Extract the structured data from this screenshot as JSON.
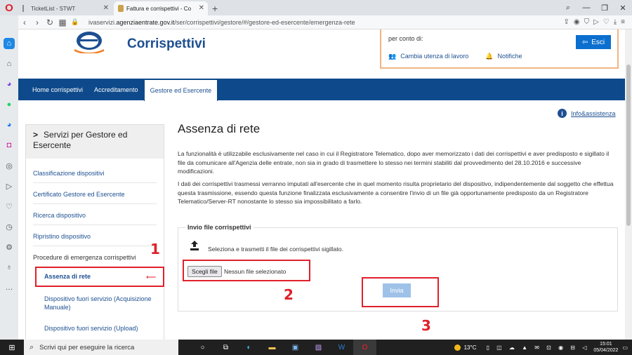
{
  "browser": {
    "tabs": [
      {
        "title": "TicketList - STWT",
        "active": false
      },
      {
        "title": "Fattura e corrispettivi - Co",
        "active": true
      }
    ],
    "url_prefix": "ivaservizi.",
    "url_domain": "agenziaentrate.gov.it",
    "url_path": "/ser/corrispettivi/gestore/#/gestore-ed-esercente/emergenza-rete"
  },
  "header": {
    "app_title": "Corrispettivi",
    "on_behalf_label": "per conto di:",
    "change_user_label": "Cambia utenza di lavoro",
    "notifications_label": "Notifiche",
    "exit_label": "Esci"
  },
  "nav": {
    "items": [
      "Home corrispettivi",
      "Accreditamento",
      "Gestore ed Esercente"
    ],
    "active_index": 2
  },
  "help_link": "Info&assistenza",
  "left_menu": {
    "title": "Servizi per Gestore ed Esercente",
    "items": [
      "Classificazione dispositivi",
      "Certificato Gestore ed Esercente",
      "Ricerca dispositivo",
      "Ripristino dispositivo"
    ],
    "group_label": "Procedure di emergenza corrispettivi",
    "sub_items": [
      "Assenza di rete",
      "Dispositivo fuori servizio (Acquisizione Manuale)",
      "Dispositivo fuori servizio (Upload)"
    ],
    "selected_sub": "Assenza di rete"
  },
  "main": {
    "title": "Assenza di rete",
    "paragraph1": "La funzionalità è utilizzabile esclusivamente nel caso in cui il Registratore Telematico, dopo aver memorizzato i dati dei corrispettivi e aver predisposto e sigillato il file da comunicare all'Agenzia delle entrate, non sia in grado di trasmettere lo stesso nei termini stabiliti dal provvedimento del 28.10.2016 e successive modificazioni.",
    "paragraph2": "I dati dei corrispettivi trasmessi verranno imputati all'esercente che in quel momento risulta proprietario del dispositivo, indipendentemente dal soggetto che effettua questa trasmissione, essendo questa funzione finalizzata esclusivamente a consentire l'invio di un file già opportunamente predisposto da un Registratore Telematico/Server-RT nonostante lo stesso sia impossibilitato a farlo.",
    "upload_legend": "Invio file corrispettivi",
    "upload_instruction": "Seleziona e trasmetti il file dei corrispettivi sigillato.",
    "choose_file_label": "Scegli file",
    "no_file_label": "Nessun file selezionato",
    "send_label": "Invia"
  },
  "annotations": [
    "1",
    "2",
    "3"
  ],
  "taskbar": {
    "search_placeholder": "Scrivi qui per eseguire la ricerca",
    "temperature": "13°C",
    "time": "15:01",
    "date": "05/04/2022"
  },
  "colors": {
    "brand_blue": "#0e4a8b",
    "annotation_red": "#e0202a",
    "exit_button": "#0b6fcf",
    "user_box_border": "#f0b483"
  }
}
